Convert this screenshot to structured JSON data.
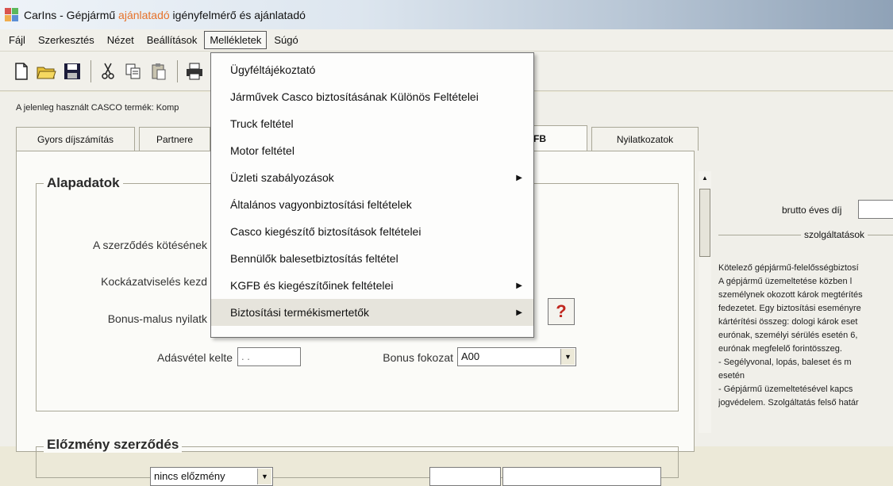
{
  "window": {
    "title_prefix": "CarIns - Gépjármű ",
    "title_accent": "ajánlatadó",
    "title_suffix": " igényfelmérő és ajánlatadó"
  },
  "menubar": [
    "Fájl",
    "Szerkesztés",
    "Nézet",
    "Beállítások",
    "Mellékletek",
    "Súgó"
  ],
  "content": {
    "product_line": "A jelenleg használt CASCO termék: Komp",
    "tabs": [
      "Gyors díjszámítás",
      "Partnere",
      "FB",
      "Nyilatkozatok"
    ],
    "alapadatok": {
      "title": "Alapadatok",
      "label_szerzodes": "A szerződés kötésének",
      "label_kockazat": "Kockázatviselés kezd",
      "label_bonus_nyil": "Bonus-malus nyilatk",
      "label_adasvetel": "Adásvétel kelte",
      "adasvetel_value": ". .",
      "label_bonus_fokozat": "Bonus fokozat",
      "bonus_fokozat_value": "A00"
    },
    "elozmeny": {
      "title": "Előzmény szerződés",
      "combo_value": "nincs előzmény"
    },
    "right": {
      "brutto_label": "brutto éves díj",
      "szolg_label": "szolgáltatások",
      "info_lines": [
        "Kötelező gépjármű-felelősségbiztosí",
        "  A gépjármű üzemeltetése közben l",
        "személynek okozott károk megtérítés",
        "fedezetet. Egy biztosítási eseményre",
        "kártérítési összeg: dologi károk eset",
        "eurónak, személyi sérülés esetén 6,",
        "eurónak megfelelő forintösszeg.",
        " -  Segélyvonal, lopás, baleset és m",
        "esetén",
        " -  Gépjármű üzemeltetésével kapcs",
        "jogvédelem. Szolgáltatás felső határ"
      ]
    }
  },
  "dropdown_menu": {
    "items": [
      {
        "label": "Ügyféltájékoztató",
        "submenu": false
      },
      {
        "label": "Járművek Casco biztosításának Különös Feltételei",
        "submenu": false
      },
      {
        "label": "Truck feltétel",
        "submenu": false
      },
      {
        "label": "Motor feltétel",
        "submenu": false
      },
      {
        "label": "Üzleti szabályozások",
        "submenu": true
      },
      {
        "label": "Általános vagyonbiztosítási feltételek",
        "submenu": false
      },
      {
        "label": "Casco kiegészítő biztosítások feltételei",
        "submenu": false
      },
      {
        "label": "Bennülők balesetbiztosítás feltétel",
        "submenu": false
      },
      {
        "label": "KGFB és kiegészítőinek feltételei",
        "submenu": true
      },
      {
        "label": "Biztosítási termékismertetők",
        "submenu": true
      }
    ]
  },
  "toolbar_icons": [
    "new-document-icon",
    "open-folder-icon",
    "save-icon",
    "cut-icon",
    "copy-icon",
    "paste-icon",
    "print-icon"
  ],
  "colors": {
    "title_accent": "#e6722a",
    "help_icon": "#c0271f",
    "menu_highlight": "#e6e4dc"
  }
}
